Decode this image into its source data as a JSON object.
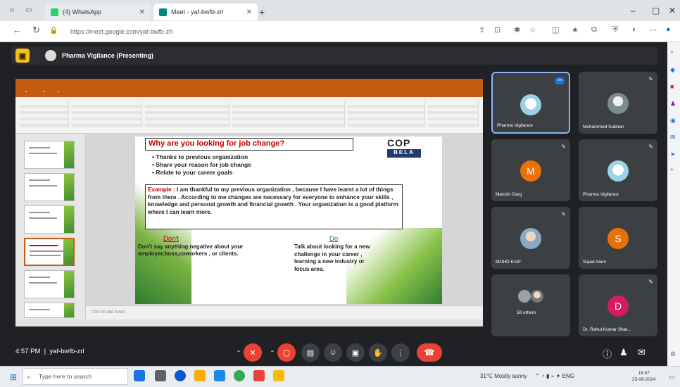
{
  "browser": {
    "tabs": [
      {
        "label": "(4) WhatsApp"
      },
      {
        "label": "Meet - yaf-bwfb-zrl"
      }
    ],
    "url": "https://meet.google.com/yaf-bwfb-zrl"
  },
  "meet": {
    "presenter_banner": "Pharma Vigilance (Presenting)",
    "meeting_time": "4:57 PM",
    "meeting_code": "yaf-bwfb-zrl"
  },
  "slide": {
    "question": "Why are you looking for job change?",
    "logo_top": "COP",
    "logo_bottom": "BELA",
    "bullets": [
      "Thanks to previous organization",
      "Share your reason for job change",
      "Relate to your career goals"
    ],
    "example_label": "Example :",
    "example_text": " I am thankful to my previous organization , because I have learnt a lot of things from there . According to me changes are necessary for everyone to enhance your skills , knowledge and personal growth and financial growth . Your organization is a good platform where I can learn more.",
    "dont_heading": "Don't",
    "do_heading": "Do",
    "dont_text": "Don't say anything negative about your employer,boss,coworkers , or clients.",
    "do_text": "Talk about looking for a new challenge in your career , learning a new industry or focus  area.",
    "notes_placeholder": "Click to add notes"
  },
  "participants": [
    {
      "name": "Pharma Vigilance",
      "type": "pic"
    },
    {
      "name": "Mohammed Subhan",
      "type": "pic"
    },
    {
      "name": "Manish Garg",
      "type": "initial",
      "initial": "M",
      "color": "#e8710a"
    },
    {
      "name": "Pharma Vigilance",
      "type": "pic"
    },
    {
      "name": "MOHD KAIF",
      "type": "pic"
    },
    {
      "name": "Sajad Alam",
      "type": "initial",
      "initial": "S",
      "color": "#e8710a"
    },
    {
      "name": "58 others",
      "type": "group"
    },
    {
      "name": "Dr. Rahul Kumar Shar...",
      "type": "initial",
      "initial": "D",
      "color": "#d81b60"
    }
  ],
  "taskbar": {
    "search_placeholder": "Type here to search",
    "weather": "31°C  Mostly sunny",
    "clock_time": "16:57",
    "clock_date": "25-06-2024"
  },
  "colors": {
    "meet_bg": "#202124",
    "tile_bg": "#3c4043",
    "ppt_accent": "#c55a11",
    "hangup_red": "#ea4335"
  }
}
